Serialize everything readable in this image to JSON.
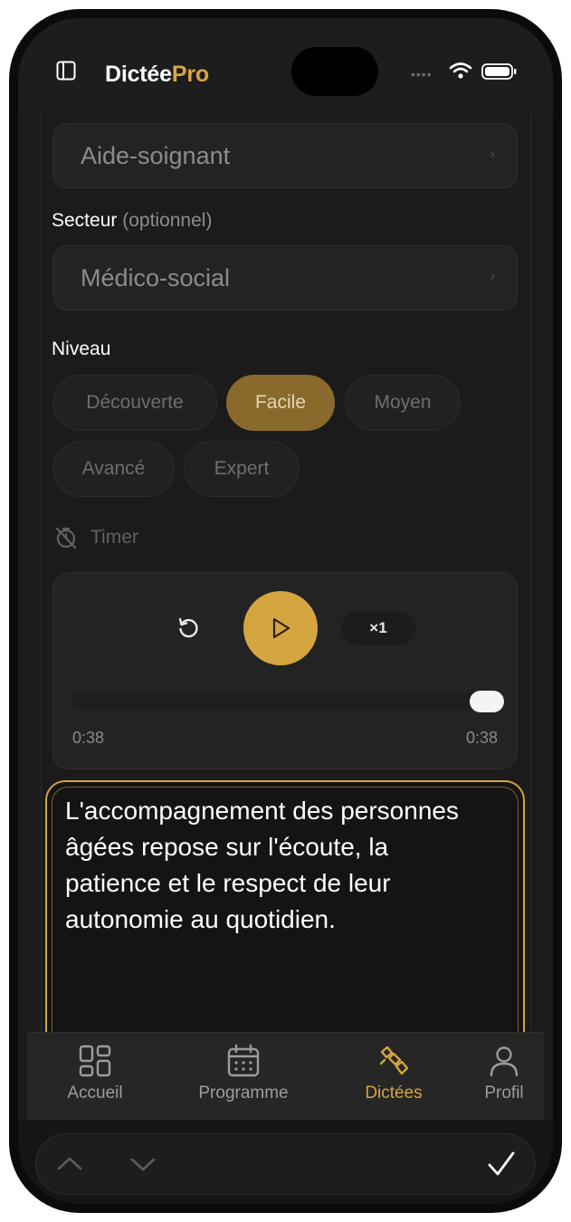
{
  "app": {
    "brand_primary": "Dictée",
    "brand_accent": "Pro"
  },
  "colors": {
    "accent": "#d5a540",
    "background": "#1b1b1c"
  },
  "form": {
    "profession_value": "Aide-soignant",
    "sector_label": "Secteur",
    "sector_optional": "(optionnel)",
    "sector_value": "Médico-social",
    "level_label": "Niveau",
    "levels": [
      "Découverte",
      "Facile",
      "Moyen",
      "Avancé",
      "Expert"
    ],
    "selected_level": "Facile",
    "timer_label": "Timer"
  },
  "player": {
    "speed": "×1",
    "elapsed": "0:38",
    "duration": "0:38",
    "progress": 1.0
  },
  "editor": {
    "text": "L'accompagnement des personnes âgées repose sur l'écoute, la patience et le respect de leur autonomie au quotidien."
  },
  "tabs": [
    {
      "label": "Accueil",
      "icon": "grid-icon",
      "active": false
    },
    {
      "label": "Programme",
      "icon": "calendar-icon",
      "active": false
    },
    {
      "label": "Dictées",
      "icon": "pen-nib-icon",
      "active": true
    },
    {
      "label": "Profil",
      "icon": "user-icon",
      "active": false
    }
  ]
}
